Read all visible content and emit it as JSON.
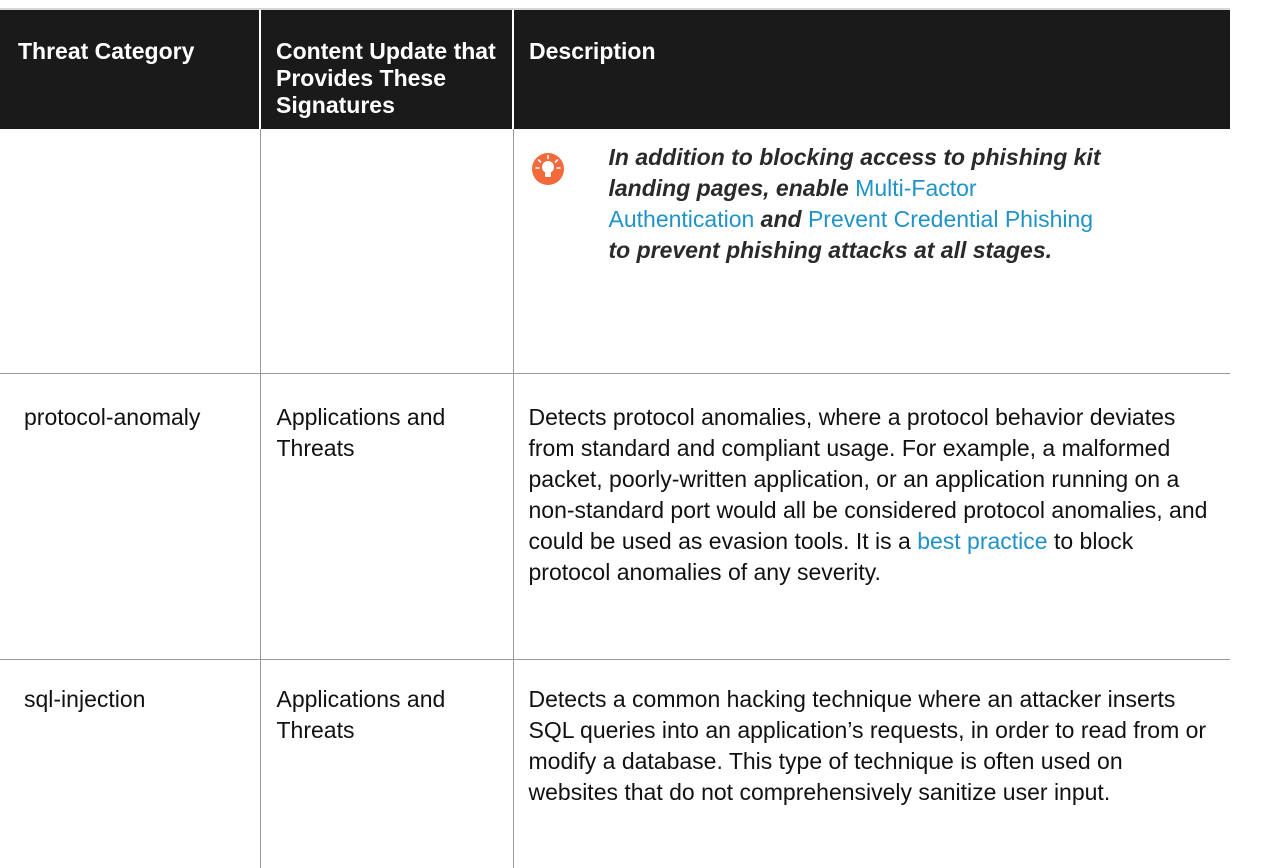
{
  "table": {
    "headers": {
      "category": "Threat Category",
      "content_update": "Content Update that Provides These Signatures",
      "description": "Description"
    },
    "tip_row": {
      "icon": "lightbulb-icon",
      "text_1": "In addition to blocking access to phishing kit landing pages, enable ",
      "link_1": "Multi-Factor Authentication",
      "text_2": " and ",
      "link_2": "Prevent Credential Phishing",
      "text_3": " to prevent phishing attacks at all stages."
    },
    "rows": [
      {
        "category": "protocol-anomaly",
        "content_update": "Applications and Threats",
        "description_before_link": "Detects protocol anomalies, where a protocol behavior deviates from standard and compliant usage. For example, a malformed packet, poorly-written application, or an application running on a non-standard port would all be considered protocol anomalies, and could be used as evasion tools. It is a ",
        "description_link": "best practice",
        "description_after_link": " to block protocol anomalies of any severity."
      },
      {
        "category": "sql-injection",
        "content_update": "Applications and Threats",
        "description": "Detects a common hacking technique where an attacker inserts SQL queries into an application’s requests, in order to read from or modify a database. This type of technique is often used on websites that do not comprehensively sanitize user input."
      }
    ]
  },
  "colors": {
    "header_bg": "#1a1a1a",
    "link": "#1f93c8",
    "tip_icon": "#f26a3b"
  }
}
